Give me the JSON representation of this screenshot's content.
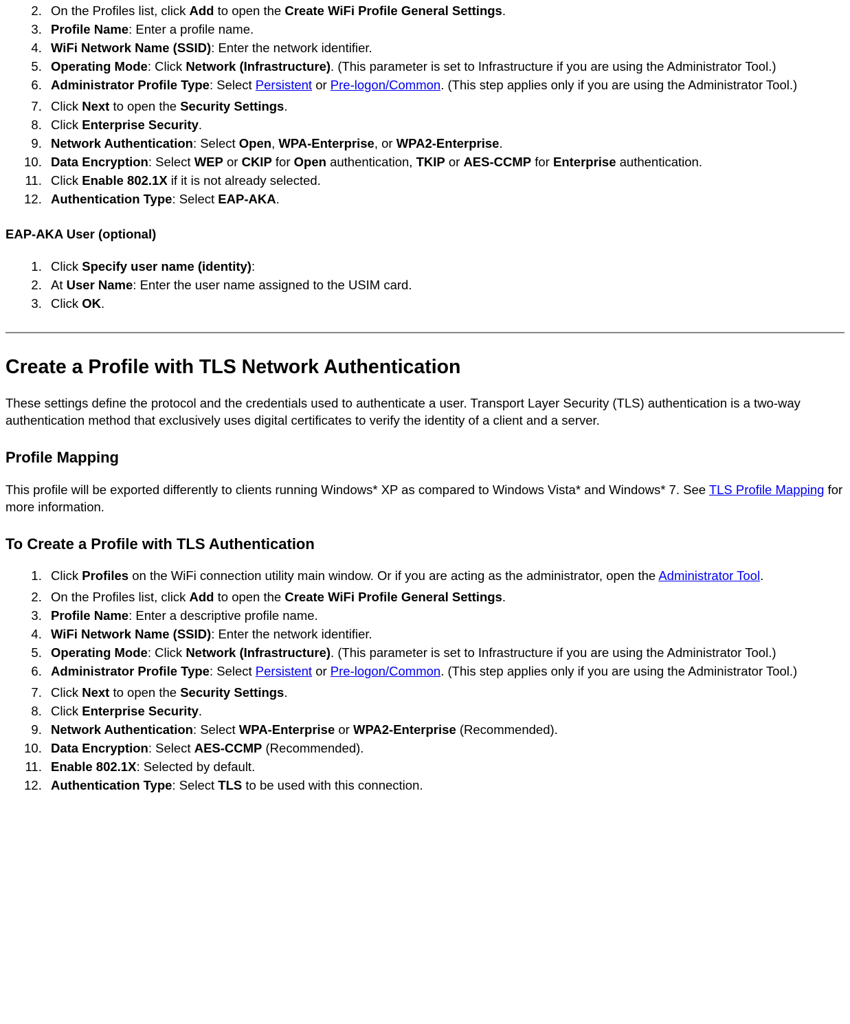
{
  "list1": {
    "i2": {
      "pre": "On the Profiles list, click ",
      "b1": "Add",
      "mid": " to open the ",
      "b2": "Create WiFi Profile General Settings",
      "post": "."
    },
    "i3": {
      "b1": "Profile Name",
      "post": ": Enter a profile name."
    },
    "i4": {
      "b1": "WiFi Network Name (SSID)",
      "post": ": Enter the network identifier."
    },
    "i5": {
      "b1": "Operating Mode",
      "mid": ": Click ",
      "b2": "Network (Infrastructure)",
      "post": ". (This parameter is set to Infrastructure if you are using the Administrator Tool.)"
    },
    "i6": {
      "b1": "Administrator Profile Type",
      "mid": ": Select ",
      "link1": "Persistent",
      "sep": " or ",
      "link2": "Pre-logon/Common",
      "post": ". (This step applies only if you are using the Administrator Tool.)"
    },
    "i7": {
      "pre": "Click ",
      "b1": "Next",
      "mid": " to open the ",
      "b2": "Security Settings",
      "post": "."
    },
    "i8": {
      "pre": "Click ",
      "b1": "Enterprise Security",
      "post": "."
    },
    "i9": {
      "b1": "Network Authentication",
      "mid": ": Select ",
      "b2": "Open",
      "sep1": ", ",
      "b3": "WPA-Enterprise",
      "sep2": ", or ",
      "b4": "WPA2-Enterprise",
      "post": "."
    },
    "i10": {
      "b1": "Data Encryption",
      "mid": ": Select ",
      "b2": "WEP",
      "sep1": " or ",
      "b3": "CKIP",
      "sep2": " for ",
      "b4": "Open",
      "sep3": " authentication, ",
      "b5": "TKIP",
      "sep4": " or ",
      "b6": "AES-CCMP",
      "sep5": " for ",
      "b7": "Enterprise",
      "post": " authentication."
    },
    "i11": {
      "pre": "Click ",
      "b1": "Enable 802.1X",
      "post": " if it is not already selected."
    },
    "i12": {
      "b1": "Authentication Type",
      "mid": ": Select ",
      "b2": "EAP-AKA",
      "post": "."
    }
  },
  "h4_eapaka": "EAP-AKA User (optional)",
  "list2": {
    "i1": {
      "pre": "Click ",
      "b1": "Specify user name (identity)",
      "post": ":"
    },
    "i2": {
      "pre": "At ",
      "b1": "User Name",
      "post": ": Enter the user name assigned to the USIM card."
    },
    "i3": {
      "pre": "Click ",
      "b1": "OK",
      "post": "."
    }
  },
  "h2_tls": "Create a Profile with TLS Network Authentication",
  "p_tls_intro": "These settings define the protocol and the credentials used to authenticate a user. Transport Layer Security (TLS) authentication is a two-way authentication method that exclusively uses digital certificates to verify the identity of a client and a server.",
  "h3_mapping": "Profile Mapping",
  "p_mapping": {
    "pre": "This profile will be exported differently to clients running Windows* XP as compared to Windows Vista* and Windows* 7. See ",
    "link": "TLS Profile Mapping",
    "post": " for more information."
  },
  "h3_create": "To Create a Profile with TLS Authentication",
  "list3": {
    "i1": {
      "pre": "Click ",
      "b1": "Profiles",
      "mid": " on the WiFi connection utility main window. Or if you are acting as the administrator, open the ",
      "link1": "Administrator Tool",
      "post": "."
    },
    "i2": {
      "pre": "On the Profiles list, click ",
      "b1": "Add",
      "mid": " to open the ",
      "b2": "Create WiFi Profile General Settings",
      "post": "."
    },
    "i3": {
      "b1": "Profile Name",
      "post": ": Enter a descriptive profile name."
    },
    "i4": {
      "b1": "WiFi Network Name (SSID)",
      "post": ": Enter the network identifier."
    },
    "i5": {
      "b1": "Operating Mode",
      "mid": ": Click ",
      "b2": "Network (Infrastructure)",
      "post": ". (This parameter is set to Infrastructure if you are using the Administrator Tool.)"
    },
    "i6": {
      "b1": "Administrator Profile Type",
      "mid": ": Select ",
      "link1": "Persistent",
      "sep": " or ",
      "link2": "Pre-logon/Common",
      "post": ". (This step applies only if you are using the Administrator Tool.)"
    },
    "i7": {
      "pre": "Click ",
      "b1": "Next",
      "mid": " to open the ",
      "b2": "Security Settings",
      "post": "."
    },
    "i8": {
      "pre": "Click ",
      "b1": "Enterprise Security",
      "post": "."
    },
    "i9": {
      "b1": "Network Authentication",
      "mid": ": Select ",
      "b2": "WPA-Enterprise",
      "sep1": " or ",
      "b3": "WPA2-Enterprise",
      "post": " (Recommended)."
    },
    "i10": {
      "b1": "Data Encryption",
      "mid": ": Select ",
      "b2": "AES-CCMP",
      "post": " (Recommended)."
    },
    "i11": {
      "b1": "Enable 802.1X",
      "post": ": Selected by default."
    },
    "i12": {
      "b1": "Authentication Type",
      "mid": ": Select ",
      "b2": "TLS",
      "post": " to be used with this connection."
    }
  }
}
